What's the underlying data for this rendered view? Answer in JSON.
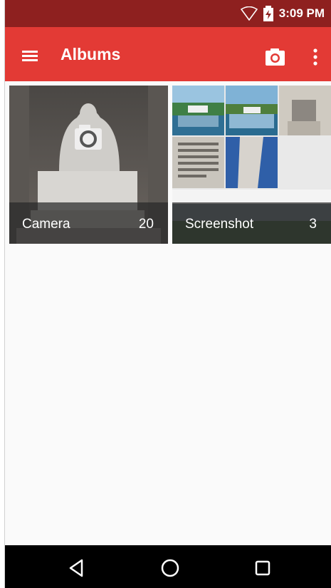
{
  "status_bar": {
    "time": "3:09 PM"
  },
  "app_bar": {
    "title": "Albums",
    "menu_icon": "hamburger-menu-icon",
    "camera_icon": "camera-icon",
    "more_icon": "more-vert-icon"
  },
  "albums": [
    {
      "name": "Camera",
      "count": "20"
    },
    {
      "name": "Screenshot",
      "count": "3"
    }
  ],
  "nav_bar": {
    "back_icon": "back-icon",
    "home_icon": "home-icon",
    "recents_icon": "recents-icon"
  },
  "colors": {
    "status_bar": "#8e201f",
    "app_bar": "#e33a35",
    "background": "#fafafa"
  }
}
